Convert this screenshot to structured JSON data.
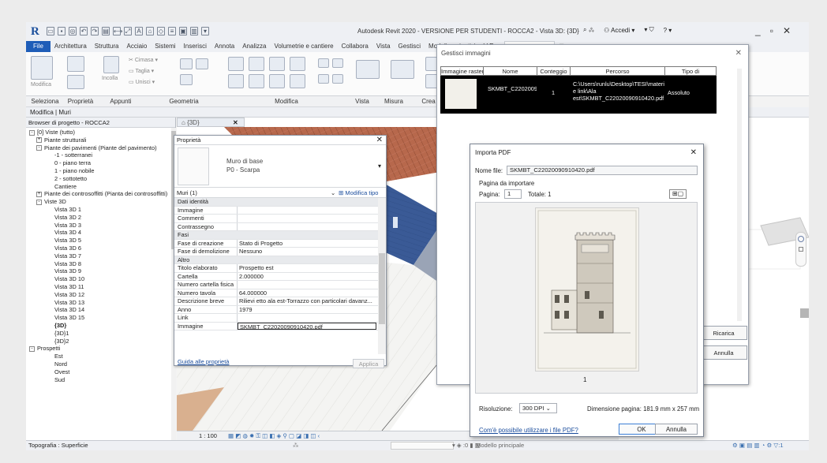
{
  "window": {
    "title": "Autodesk Revit 2020 - VERSIONE PER STUDENTI - ROCCA2 - Vista 3D: {3D}",
    "login": "Accedi",
    "help": "?"
  },
  "ribbon": {
    "tabs": [
      "File",
      "Architettura",
      "Struttura",
      "Acciaio",
      "Sistemi",
      "Inserisci",
      "Annota",
      "Analizza",
      "Volumetrie e cantiere",
      "Collabora",
      "Vista",
      "Gestisci",
      "Moduli aggiuntivi",
      "V-Ray",
      "Modifica | Muri"
    ],
    "active_tab": "Modifica | Muri",
    "tools": {
      "modify": "Modifica",
      "paste": "Incolla",
      "cope": "Cimasa",
      "cut": "Taglia",
      "join": "Unisci"
    },
    "panels": [
      "Seleziona",
      "Proprietà",
      "Appunti",
      "Geometria",
      "Modifica",
      "Vista",
      "Misura",
      "Crea"
    ],
    "context_label": "Modifica | Muri"
  },
  "browser": {
    "title": "Browser di progetto - ROCCA2",
    "items": [
      {
        "label": "[0] Viste (tutto)",
        "level": 0,
        "exp": "-"
      },
      {
        "label": "Piante strutturali",
        "level": 1,
        "exp": "+"
      },
      {
        "label": "Piante dei pavimenti (Piante del pavimento)",
        "level": 1,
        "exp": "-"
      },
      {
        "label": "-1 - sotterranei",
        "level": 2
      },
      {
        "label": "0 - piano terra",
        "level": 2
      },
      {
        "label": "1 - piano nobile",
        "level": 2
      },
      {
        "label": "2 - sottotetto",
        "level": 2
      },
      {
        "label": "Cantiere",
        "level": 2
      },
      {
        "label": "Piante dei controsoffitti (Pianta dei controsoffitti)",
        "level": 1,
        "exp": "+"
      },
      {
        "label": "Viste 3D",
        "level": 1,
        "exp": "-"
      },
      {
        "label": "Vista 3D 1",
        "level": 2
      },
      {
        "label": "Vista 3D 2",
        "level": 2
      },
      {
        "label": "Vista 3D 3",
        "level": 2
      },
      {
        "label": "Vista 3D 4",
        "level": 2
      },
      {
        "label": "Vista 3D 5",
        "level": 2
      },
      {
        "label": "Vista 3D 6",
        "level": 2
      },
      {
        "label": "Vista 3D 7",
        "level": 2
      },
      {
        "label": "Vista 3D 8",
        "level": 2
      },
      {
        "label": "Vista 3D 9",
        "level": 2
      },
      {
        "label": "Vista 3D 10",
        "level": 2
      },
      {
        "label": "Vista 3D 11",
        "level": 2
      },
      {
        "label": "Vista 3D 12",
        "level": 2
      },
      {
        "label": "Vista 3D 13",
        "level": 2
      },
      {
        "label": "Vista 3D 14",
        "level": 2
      },
      {
        "label": "Vista 3D 15",
        "level": 2
      },
      {
        "label": "{3D}",
        "level": 2,
        "bold": true
      },
      {
        "label": "{3D}1",
        "level": 2
      },
      {
        "label": "{3D}2",
        "level": 2
      },
      {
        "label": "Prospetti",
        "level": 0,
        "exp": "-"
      },
      {
        "label": "Est",
        "level": 2
      },
      {
        "label": "Nord",
        "level": 2
      },
      {
        "label": "Ovest",
        "level": 2
      },
      {
        "label": "Sud",
        "level": 2
      }
    ]
  },
  "view": {
    "tab_label": "{3D}",
    "scale": "1 : 100"
  },
  "properties": {
    "title": "Proprietà",
    "type_name_1": "Muro di base",
    "type_name_2": "P0 - Scarpa",
    "selection": "Muri (1)",
    "edit_type": "Modifica tipo",
    "rows": [
      {
        "k": "Dati identità",
        "v": "",
        "sec": true
      },
      {
        "k": "Immagine",
        "v": ""
      },
      {
        "k": "Commenti",
        "v": ""
      },
      {
        "k": "Contrassegno",
        "v": ""
      },
      {
        "k": "Fasi",
        "v": "",
        "sec": true
      },
      {
        "k": "Fase di creazione",
        "v": "Stato di Progetto"
      },
      {
        "k": "Fase di demolizione",
        "v": "Nessuno"
      },
      {
        "k": "Altro",
        "v": "",
        "sec": true
      },
      {
        "k": "Titolo elaborato",
        "v": "Prospetto est"
      },
      {
        "k": "Cartella",
        "v": "2.000000"
      },
      {
        "k": "Numero cartella fisica",
        "v": ""
      },
      {
        "k": "Numero tavola",
        "v": "64.000000"
      },
      {
        "k": "Descrizione breve",
        "v": "Rilievi etto ala est-Torrazzo con particolari davanz..."
      },
      {
        "k": "Anno",
        "v": "1979"
      },
      {
        "k": "Link",
        "v": ""
      },
      {
        "k": "Immagine",
        "v": "SKMBT_C22020090910420.pdf",
        "hl": true
      }
    ],
    "help_link": "Guida alle proprietà",
    "apply": "Applica"
  },
  "manage_images": {
    "title": "Gestisci immagini",
    "columns": [
      "Immagine raster",
      "Nome",
      "Conteggio",
      "Percorso",
      "Tipo di"
    ],
    "row": {
      "name": "SKMBT_C22020090910420.pdf",
      "count": "1",
      "path": "C:\\Users\\runlu\\Desktop\\TESI\\materiali e link\\Ala est\\SKMBT_C22020090910420.pdf",
      "type": "Assoluto"
    },
    "reload": "Ricarica",
    "cancel": "Annulla"
  },
  "import_pdf": {
    "title": "Importa PDF",
    "filename_label": "Nome file:",
    "filename": "SKMBT_C22020090910420.pdf",
    "group_label": "Pagina da importare",
    "page_label": "Pagina:",
    "page_value": "1",
    "total_label": "Totale:",
    "total_value": "1",
    "page_number": "1",
    "resolution_label": "Risoluzione:",
    "resolution_value": "300 DPI",
    "page_size": "Dimensione pagina: 181.9 mm x 257 mm",
    "help_link": "Com'è possibile utilizzare i file PDF?",
    "ok": "OK",
    "cancel": "Annulla"
  },
  "status": {
    "left": "Topografia : Superficie",
    "model": "Modello principale",
    "filter": ":1"
  }
}
